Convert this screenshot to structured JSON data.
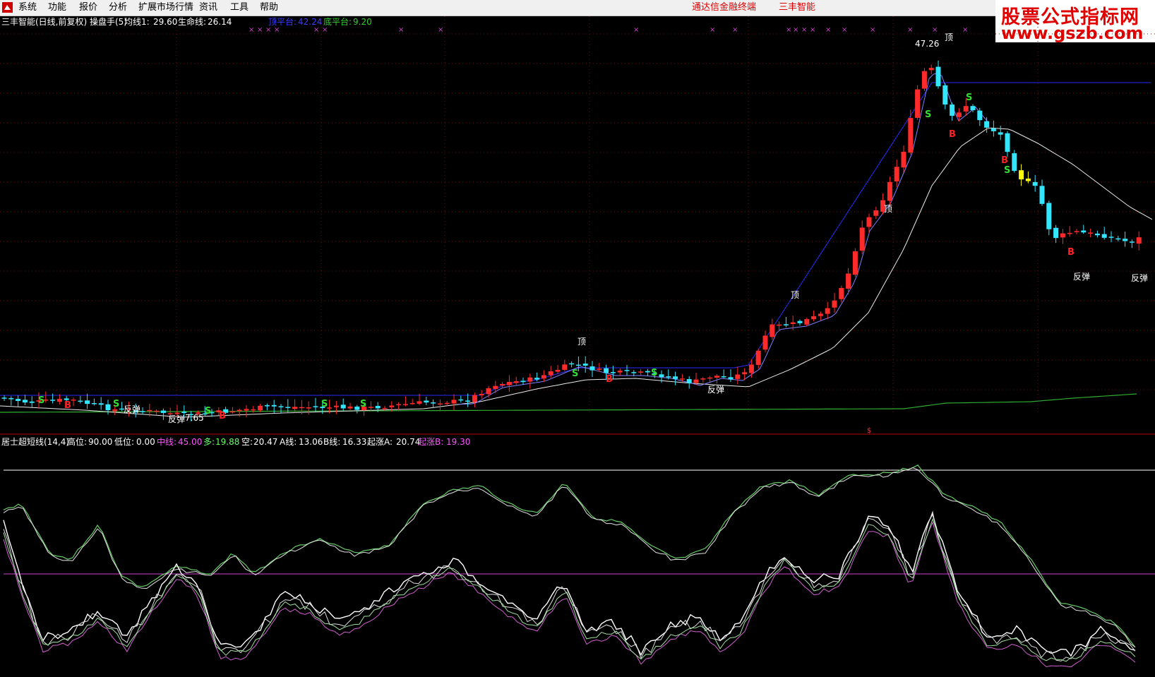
{
  "menu": {
    "items": [
      "系统",
      "功能",
      "报价",
      "分析",
      "扩展市场行情",
      "资讯",
      "工具",
      "帮助"
    ],
    "title_left": "通达信金融终端",
    "title_right": "三丰智能"
  },
  "logo": {
    "line1": "股票公式指标网",
    "line2": "www.gszb.com"
  },
  "colors": {
    "up": "#ff2a2a",
    "down": "#33e6ff",
    "menu_title": "#e00000",
    "background": "#000000"
  },
  "main_panel": {
    "title": "三丰智能(日线,前复权) 操盘手(5)",
    "ma1_label": "均线1:",
    "ma1_value": "29.60",
    "life_label": "生命线:",
    "life_value": "26.14",
    "top_platform_label": "顶平台:",
    "top_platform_value": "42.24",
    "bottom_platform_label": "底平台:",
    "bottom_platform_value": "9.20",
    "peak_label": "47.26",
    "low_label": "7.65",
    "signals": {
      "top": "顶",
      "rebound": "反弹",
      "sell": "S",
      "buy": "B"
    }
  },
  "sub_panel": {
    "title": "居士超短线(14,4)",
    "high_label": "高位:",
    "high_value": "90.00",
    "low_label": "低位:",
    "low_value": "0.00",
    "mid_label": "中线:",
    "mid_value": "45.00",
    "long_label": "多:",
    "long_value": "19.88",
    "short_label": "空:",
    "short_value": "20.47",
    "a_label": "A线:",
    "a_value": "13.06",
    "b_label": "B线:",
    "b_value": "16.33",
    "risea_label": "起涨A:",
    "risea_value": "20.74",
    "riseb_label": "起涨B:",
    "riseb_value": "19.30"
  }
}
